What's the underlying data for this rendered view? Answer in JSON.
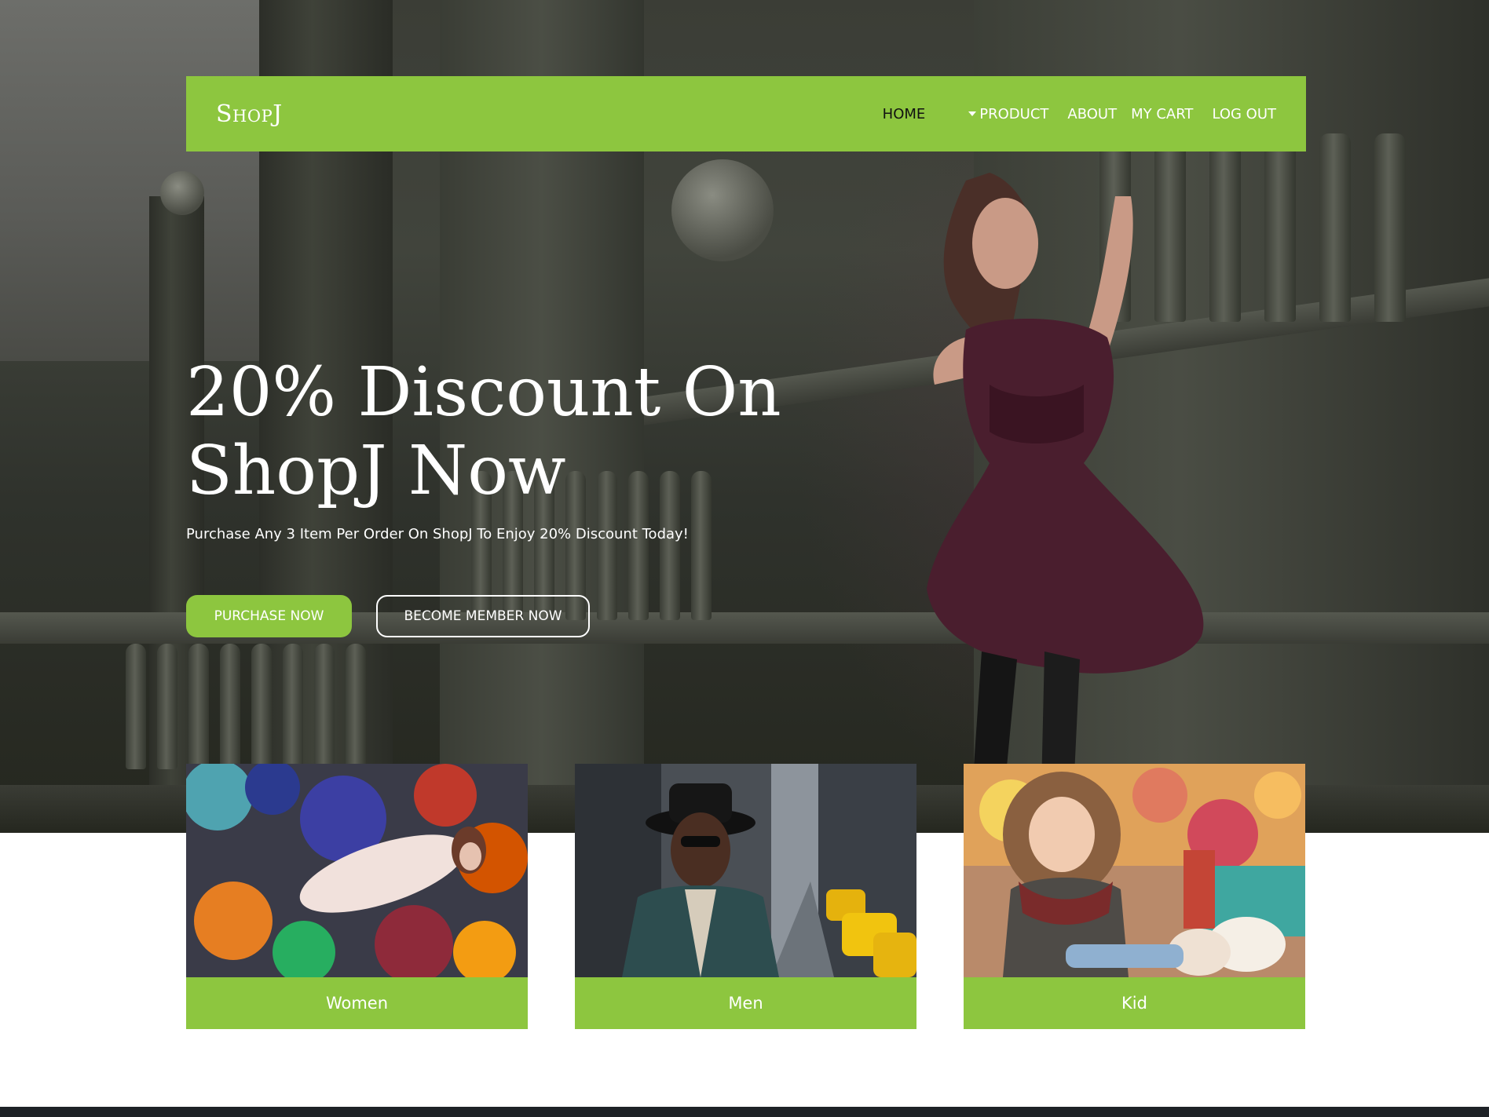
{
  "brand": {
    "name": "ShopJ"
  },
  "nav": {
    "items": [
      {
        "label": "HOME",
        "active": true
      },
      {
        "label": "PRODUCT",
        "has_dropdown": true
      },
      {
        "label": "ABOUT"
      },
      {
        "label": "MY CART"
      },
      {
        "label": "LOG OUT"
      }
    ]
  },
  "hero": {
    "title_line1": "20% Discount On",
    "title_line2": "ShopJ Now",
    "subtitle": "Purchase Any 3 Item Per Order On ShopJ To Enjoy 20% Discount Today!",
    "primary_button": "PURCHASE NOW",
    "secondary_button": "BECOME MEMBER NOW"
  },
  "categories": [
    {
      "label": "Women"
    },
    {
      "label": "Men"
    },
    {
      "label": "Kid"
    }
  ],
  "colors": {
    "accent": "#8dc63f",
    "text_light": "#ffffff",
    "nav_active": "#111111",
    "hero_dark": "#2f322c"
  }
}
